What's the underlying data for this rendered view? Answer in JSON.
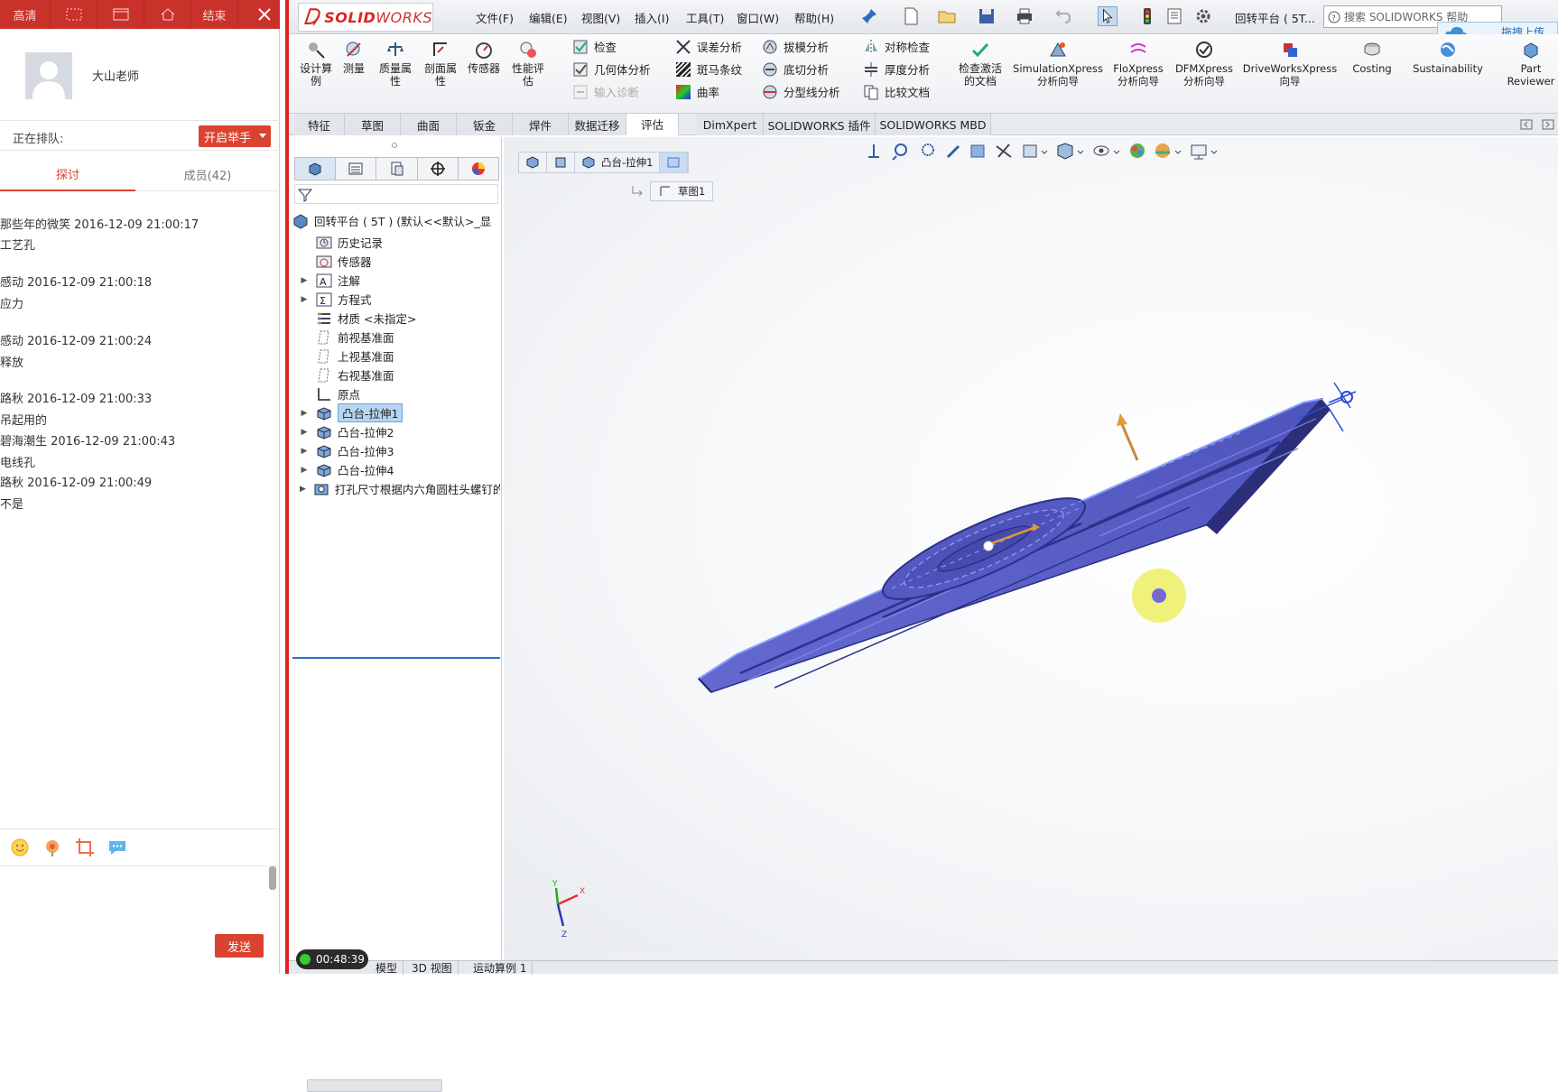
{
  "chat": {
    "toolbar": [
      "高清",
      "",
      "",
      "",
      "结束"
    ],
    "user_name": "大山老师",
    "queue_label": "正在排队:",
    "raise_hand": "开启举手",
    "tabs": {
      "discuss": "探讨",
      "members": "成员(42)"
    },
    "messages": [
      {
        "head": "那些年的微笑 2016-12-09 21:00:17",
        "body": "工艺孔"
      },
      {
        "head": "感动 2016-12-09 21:00:18",
        "body": "应力"
      },
      {
        "head": "感动 2016-12-09 21:00:24",
        "body": "释放"
      },
      {
        "head": "路秋 2016-12-09 21:00:33",
        "body": "吊起用的"
      },
      {
        "head": "碧海潮生 2016-12-09 21:00:43",
        "body": "电线孔"
      },
      {
        "head": "路秋 2016-12-09 21:00:49",
        "body": "不是"
      }
    ],
    "send": "发送"
  },
  "solidworks": {
    "logo_text_bold": "SOLID",
    "logo_text": "WORKS",
    "menu": [
      "文件(F)",
      "编辑(E)",
      "视图(V)",
      "插入(I)",
      "工具(T)",
      "窗口(W)",
      "帮助(H)"
    ],
    "doc_title": "回转平台 ( 5T...",
    "search_placeholder": "搜索 SOLIDWORKS 帮助",
    "upload": "拖拽上传",
    "ribbon_big": [
      {
        "label": "设计算\n例",
        "icon": "design-study-icon"
      },
      {
        "label": "测量",
        "icon": "measure-icon"
      },
      {
        "label": "质量属\n性",
        "icon": "mass-properties-icon"
      },
      {
        "label": "剖面属\n性",
        "icon": "section-properties-icon"
      },
      {
        "label": "传感器",
        "icon": "sensor-icon"
      },
      {
        "label": "性能评\n估",
        "icon": "performance-icon"
      }
    ],
    "ribbon_small": [
      {
        "label": "检查",
        "icon": "check-icon",
        "enabled": true
      },
      {
        "label": "几何体分析",
        "icon": "geometry-analysis-icon",
        "enabled": true
      },
      {
        "label": "输入诊断",
        "icon": "import-diagnostics-icon",
        "enabled": false
      },
      {
        "label": "误差分析",
        "icon": "deviation-analysis-icon",
        "enabled": true
      },
      {
        "label": "斑马条纹",
        "icon": "zebra-stripes-icon",
        "enabled": true
      },
      {
        "label": "曲率",
        "icon": "curvature-icon",
        "enabled": true
      },
      {
        "label": "拔模分析",
        "icon": "draft-analysis-icon",
        "enabled": true
      },
      {
        "label": "底切分析",
        "icon": "undercut-analysis-icon",
        "enabled": true
      },
      {
        "label": "分型线分析",
        "icon": "parting-line-icon",
        "enabled": true
      },
      {
        "label": "对称检查",
        "icon": "symmetry-check-icon",
        "enabled": true
      },
      {
        "label": "厚度分析",
        "icon": "thickness-analysis-icon",
        "enabled": true
      },
      {
        "label": "比较文档",
        "icon": "compare-documents-icon",
        "enabled": true
      }
    ],
    "ribbon_right": [
      {
        "label": "检查激活\n的文档",
        "icon": "check-active-document-icon"
      },
      {
        "label": "SimulationXpress\n分析向导",
        "icon": "simulationxpress-icon"
      },
      {
        "label": "FloXpress\n分析向导",
        "icon": "floxpress-icon"
      },
      {
        "label": "DFMXpress\n分析向导",
        "icon": "dfmxpress-icon"
      },
      {
        "label": "DriveWorksXpress\n向导",
        "icon": "driveworksxpress-icon"
      },
      {
        "label": "Costing",
        "icon": "costing-icon"
      },
      {
        "label": "Sustainability",
        "icon": "sustainability-icon"
      },
      {
        "label": "Part\nReviewer",
        "icon": "part-reviewer-icon"
      }
    ],
    "command_tabs": [
      "特征",
      "草图",
      "曲面",
      "钣金",
      "焊件",
      "数据迁移",
      "评估",
      "DimXpert",
      "SOLIDWORKS 插件",
      "SOLIDWORKS MBD"
    ],
    "active_tab": "评估",
    "tree": {
      "root": "回转平台 ( 5T )  (默认<<默认>_显",
      "nodes": [
        {
          "label": "历史记录",
          "icon": "history-folder-icon",
          "expandable": false
        },
        {
          "label": "传感器",
          "icon": "sensor-folder-icon",
          "expandable": false
        },
        {
          "label": "注解",
          "icon": "annotations-icon",
          "expandable": true
        },
        {
          "label": "方程式",
          "icon": "equations-icon",
          "expandable": true
        },
        {
          "label": "材质 <未指定>",
          "icon": "material-icon",
          "expandable": false
        },
        {
          "label": "前视基准面",
          "icon": "plane-icon",
          "expandable": false
        },
        {
          "label": "上视基准面",
          "icon": "plane-icon",
          "expandable": false
        },
        {
          "label": "右视基准面",
          "icon": "plane-icon",
          "expandable": false
        },
        {
          "label": "原点",
          "icon": "origin-icon",
          "expandable": false
        },
        {
          "label": "凸台-拉伸1",
          "icon": "boss-extrude-icon",
          "expandable": true,
          "selected": true
        },
        {
          "label": "凸台-拉伸2",
          "icon": "boss-extrude-icon",
          "expandable": true
        },
        {
          "label": "凸台-拉伸3",
          "icon": "boss-extrude-icon",
          "expandable": true
        },
        {
          "label": "凸台-拉伸4",
          "icon": "boss-extrude-icon",
          "expandable": true
        },
        {
          "label": "打孔尺寸根据内六角圆柱头螺钉的类",
          "icon": "hole-wizard-icon",
          "expandable": true
        }
      ]
    },
    "breadcrumb": [
      "凸台-拉伸1"
    ],
    "breadcrumb_child": "草图1",
    "axis_labels": [
      "X",
      "Y",
      "Z"
    ],
    "status_tabs": [
      "模型",
      "3D 视图",
      "运动算例 1"
    ],
    "timer": "00:48:39",
    "colors": {
      "accent_red": "#d9432f",
      "model_blue": "#5b5fc7",
      "selection_blue": "#b7d5f2"
    }
  }
}
